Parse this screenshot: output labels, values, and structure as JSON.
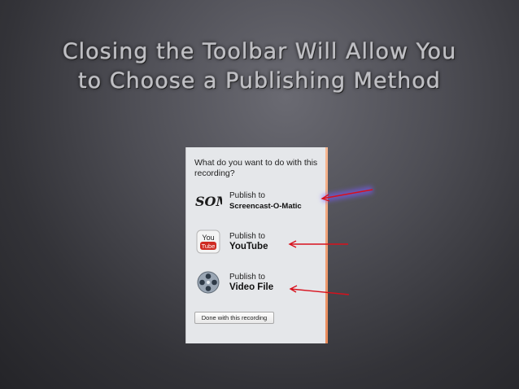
{
  "slide": {
    "title_line1": "Closing the Toolbar Will Allow You",
    "title_line2": "to Choose a Publishing Method"
  },
  "dialog": {
    "question": "What do you want to do with this recording?",
    "options": [
      {
        "icon": "som-icon",
        "line1": "Publish to",
        "line2": "Screencast-O-Matic",
        "icon_text": "SOM"
      },
      {
        "icon": "youtube-icon",
        "line1": "Publish to",
        "line2": "YouTube",
        "icon_text_top": "You",
        "icon_text_bottom": "Tube"
      },
      {
        "icon": "film-reel-icon",
        "line1": "Publish to",
        "line2": "Video File"
      }
    ],
    "done_label": "Done with this recording"
  },
  "colors": {
    "arrow": "#d8101c",
    "arrow_glow": "#7a5cff",
    "dialog_edge": "#ec8f5e",
    "youtube_red": "#cf2b22"
  }
}
